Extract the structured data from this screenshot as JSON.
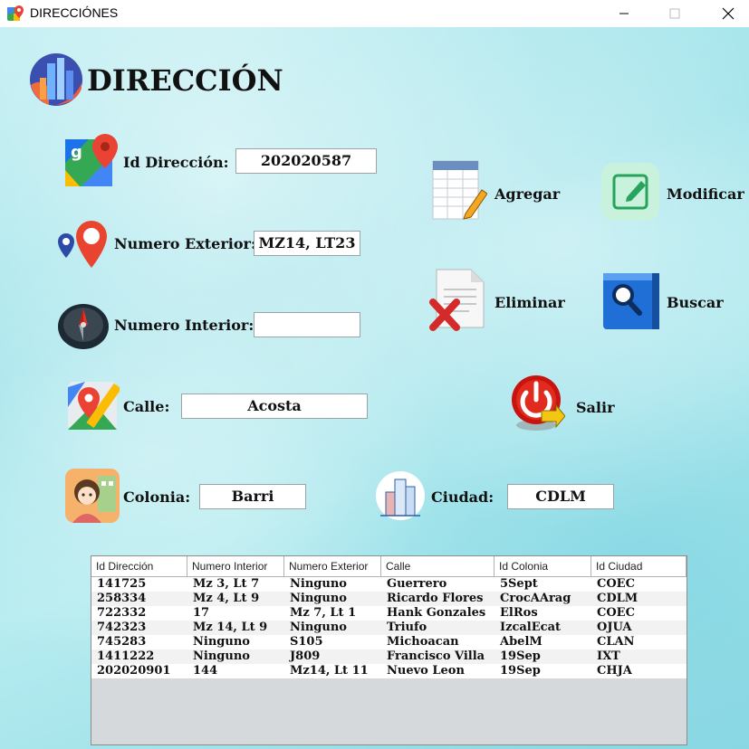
{
  "window": {
    "title": "DIRECCIÓNES",
    "controls": [
      "minimize",
      "maximize",
      "close"
    ]
  },
  "heading": "DIRECCIÓN",
  "form": {
    "id_direccion": {
      "label": "Id Dirección:",
      "value": "202020587"
    },
    "numero_exterior": {
      "label": "Numero Exterior:",
      "value": "MZ14, LT23"
    },
    "numero_interior": {
      "label": "Numero Interior:",
      "value": ""
    },
    "calle": {
      "label": "Calle:",
      "value": "Acosta"
    },
    "colonia": {
      "label": "Colonia:",
      "value": "Barri"
    },
    "ciudad": {
      "label": "Ciudad:",
      "value": "CDLM"
    }
  },
  "buttons": {
    "agregar": "Agregar",
    "modificar": "Modificar",
    "eliminar": "Eliminar",
    "buscar": "Buscar",
    "salir": "Salir"
  },
  "table": {
    "columns": [
      "Id Dirección",
      "Numero Interior",
      "Numero Exterior",
      "Calle",
      "Id Colonia",
      "Id Ciudad"
    ],
    "rows": [
      [
        "141725",
        "Mz 3, Lt 7",
        "Ninguno",
        "Guerrero",
        "5Sept",
        "COEC"
      ],
      [
        "258334",
        "Mz 4, Lt 9",
        "Ninguno",
        "Ricardo Flores",
        "CrocAArag",
        "CDLM"
      ],
      [
        "722332",
        "17",
        "Mz 7, Lt 1",
        "Hank Gonzales",
        "ElRos",
        "COEC"
      ],
      [
        "742323",
        "Mz 14, Lt 9",
        "Ninguno",
        "Triufo",
        "IzcalEcat",
        "OJUA"
      ],
      [
        "745283",
        "Ninguno",
        "S105",
        "Michoacan",
        "AbelM",
        "CLAN"
      ],
      [
        "1411222",
        "Ninguno",
        "J809",
        "Francisco Villa",
        "19Sep",
        "IXT"
      ],
      [
        "202020901",
        "144",
        "Mz14, Lt 11",
        "Nuevo Leon",
        "19Sep",
        "CHJA"
      ]
    ]
  },
  "colors": {
    "background": "#9fe3ea",
    "table_background": "#d6d9dc"
  },
  "icons": {
    "app": "map-pin-icon",
    "heading": "city-icon",
    "id_direccion": "google-maps-icon",
    "numero_exterior": "map-pins-icon",
    "numero_interior": "compass-icon",
    "calle": "maps-icon",
    "colonia": "person-neighborhood-icon",
    "ciudad": "buildings-icon",
    "agregar": "spreadsheet-pencil-icon",
    "modificar": "edit-note-icon",
    "eliminar": "document-delete-icon",
    "buscar": "search-folder-icon",
    "salir": "power-exit-icon"
  }
}
